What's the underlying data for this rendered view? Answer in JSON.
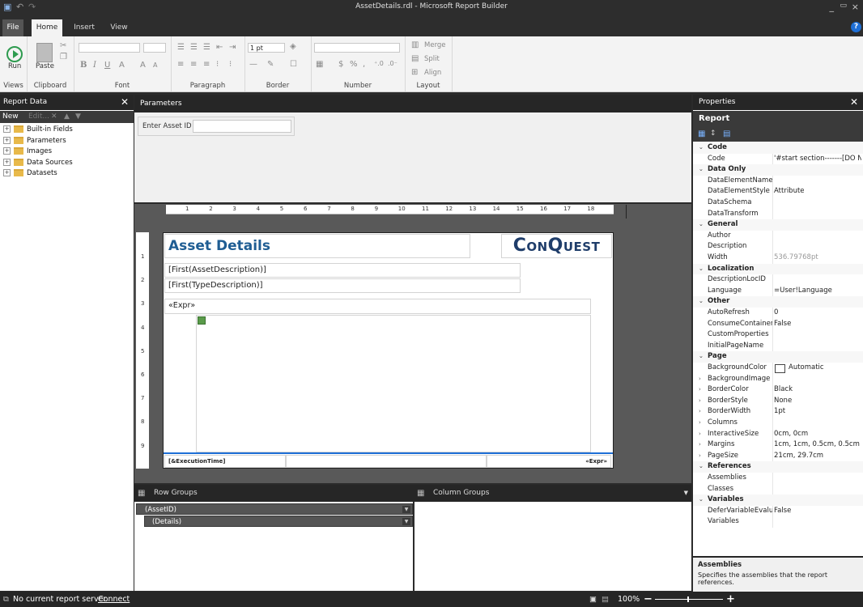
{
  "window": {
    "title": "AssetDetails.rdl - Microsoft Report Builder"
  },
  "tabs": [
    "File",
    "Home",
    "Insert",
    "View"
  ],
  "ribbon": {
    "run_label": "Run",
    "paste_label": "Paste",
    "groups": [
      "Views",
      "Clipboard",
      "Font",
      "Paragraph",
      "Border",
      "Number",
      "Layout"
    ],
    "border_width": "1 pt",
    "number_symbols": [
      "$",
      "%",
      ","
    ],
    "merge_label": "Merge",
    "split_label": "Split",
    "align_label": "Align"
  },
  "report_data": {
    "title": "Report Data",
    "new_label": "New",
    "edit_label": "Edit...",
    "items": [
      "Built-in Fields",
      "Parameters",
      "Images",
      "Data Sources",
      "Datasets"
    ]
  },
  "parameters": {
    "title": "Parameters",
    "asset_label": "Enter Asset ID",
    "asset_value": ""
  },
  "ruler": [
    "1",
    "2",
    "3",
    "4",
    "5",
    "6",
    "7",
    "8",
    "9",
    "10",
    "11",
    "12",
    "13",
    "14",
    "15",
    "16",
    "17",
    "18"
  ],
  "vruler": [
    "1",
    "2",
    "3",
    "4",
    "5",
    "6",
    "7",
    "8",
    "9"
  ],
  "report": {
    "title": "Asset Details",
    "logo": "ConQuest",
    "field1": "[First(AssetDescription)]",
    "field2": "[First(TypeDescription)]",
    "expr": "«Expr»",
    "footer_left": "[&ExecutionTime]",
    "footer_right": "«Expr»"
  },
  "groups": {
    "row_title": "Row Groups",
    "col_title": "Column Groups",
    "row_items": [
      "(AssetID)",
      "(Details)"
    ]
  },
  "properties": {
    "title": "Properties",
    "object": "Report",
    "rows": [
      {
        "cat": true,
        "name": "Code"
      },
      {
        "name": "Code",
        "value": "'#start section-------[DO NOT"
      },
      {
        "cat": true,
        "name": "Data Only"
      },
      {
        "name": "DataElementName",
        "value": ""
      },
      {
        "name": "DataElementStyle",
        "value": "Attribute"
      },
      {
        "name": "DataSchema",
        "value": ""
      },
      {
        "name": "DataTransform",
        "value": ""
      },
      {
        "cat": true,
        "name": "General"
      },
      {
        "name": "Author",
        "value": ""
      },
      {
        "name": "Description",
        "value": ""
      },
      {
        "name": "Width",
        "value": "536.79768pt",
        "gray": true
      },
      {
        "cat": true,
        "name": "Localization"
      },
      {
        "name": "DescriptionLocID",
        "value": ""
      },
      {
        "name": "Language",
        "value": "=User!Language"
      },
      {
        "cat": true,
        "name": "Other"
      },
      {
        "name": "AutoRefresh",
        "value": "0"
      },
      {
        "name": "ConsumeContainerWhitespace",
        "value": "False"
      },
      {
        "name": "CustomProperties",
        "value": ""
      },
      {
        "name": "InitialPageName",
        "value": ""
      },
      {
        "cat": true,
        "name": "Page"
      },
      {
        "name": "BackgroundColor",
        "value": "Automatic",
        "swatch": true
      },
      {
        "name": "BackgroundImage",
        "value": "",
        "exp": true
      },
      {
        "name": "BorderColor",
        "value": "Black",
        "exp": true
      },
      {
        "name": "BorderStyle",
        "value": "None",
        "exp": true
      },
      {
        "name": "BorderWidth",
        "value": "1pt",
        "exp": true
      },
      {
        "name": "Columns",
        "value": "",
        "exp": true
      },
      {
        "name": "InteractiveSize",
        "value": "0cm, 0cm",
        "exp": true
      },
      {
        "name": "Margins",
        "value": "1cm, 1cm, 0.5cm, 0.5cm",
        "exp": true
      },
      {
        "name": "PageSize",
        "value": "21cm, 29.7cm",
        "exp": true
      },
      {
        "cat": true,
        "name": "References"
      },
      {
        "name": "Assemblies",
        "value": ""
      },
      {
        "name": "Classes",
        "value": ""
      },
      {
        "cat": true,
        "name": "Variables"
      },
      {
        "name": "DeferVariableEvaluation",
        "value": "False"
      },
      {
        "name": "Variables",
        "value": ""
      }
    ],
    "desc_title": "Assemblies",
    "desc_text": "Specifies the assemblies that the report references."
  },
  "status": {
    "text": "No current report server.",
    "link": "Connect",
    "zoom": "100%"
  }
}
